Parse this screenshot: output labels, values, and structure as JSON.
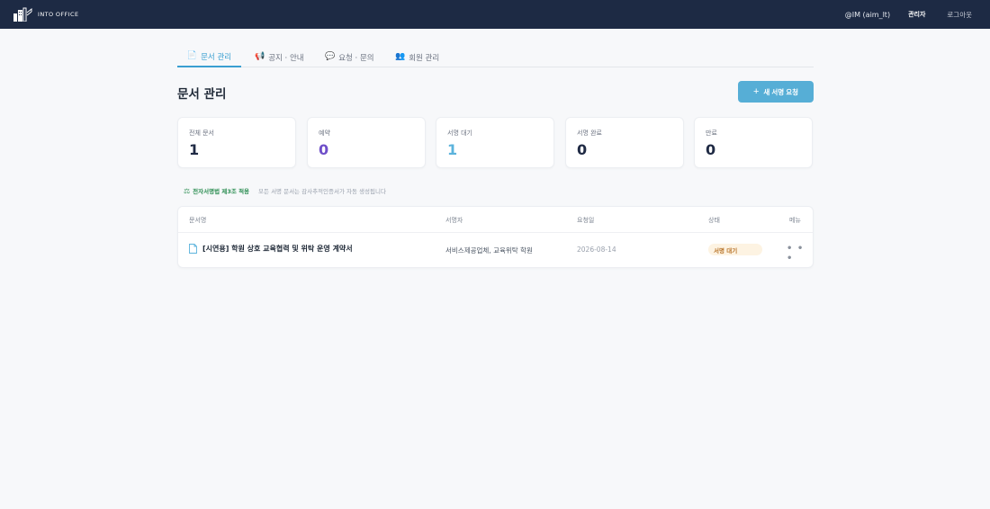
{
  "header": {
    "brand": "INTO OFFICE",
    "user": "@IM (aim_lt)",
    "role": "관리자",
    "logout": "로그아웃"
  },
  "tabs": [
    {
      "label": "문서 관리",
      "icon": "document-icon",
      "active": true
    },
    {
      "label": "공지 · 안내",
      "icon": "megaphone-icon",
      "active": false
    },
    {
      "label": "요청 · 문의",
      "icon": "speech-bubble-icon",
      "active": false
    },
    {
      "label": "회원 관리",
      "icon": "people-icon",
      "active": false
    }
  ],
  "page": {
    "title": "문서 관리",
    "new_button": "새 서명 요청"
  },
  "stats": [
    {
      "label": "전체 문서",
      "value": "1",
      "color": "#1f2a44"
    },
    {
      "label": "예약",
      "value": "0",
      "color": "#6f4fc9"
    },
    {
      "label": "서명 대기",
      "value": "1",
      "color": "#5bb3dc"
    },
    {
      "label": "서명 완료",
      "value": "0",
      "color": "#1f2a44"
    },
    {
      "label": "만료",
      "value": "0",
      "color": "#1f2a44"
    }
  ],
  "notice": {
    "bold": "전자서명법 제3조 적용",
    "text": "모든 서명 문서는 감사추적인증서가 자동 생성됩니다"
  },
  "table": {
    "headers": [
      "문서명",
      "서명자",
      "요청일",
      "상태",
      "메뉴"
    ],
    "rows": [
      {
        "name": "[시연용] 학원 상호 교육협력 및 위탁 운영 계약서",
        "signers": "서비스제공업체, 교육위탁 학원",
        "date": "2026-08-14",
        "status": "서명 대기",
        "menu": "• • •"
      }
    ]
  }
}
